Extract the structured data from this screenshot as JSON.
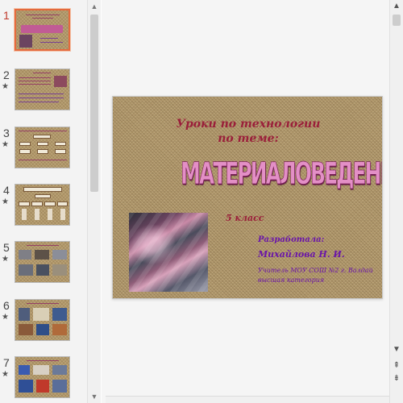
{
  "thumbnails": [
    {
      "number": "1",
      "star": ""
    },
    {
      "number": "2",
      "star": "★"
    },
    {
      "number": "3",
      "star": "★"
    },
    {
      "number": "4",
      "star": "★"
    },
    {
      "number": "5",
      "star": "★"
    },
    {
      "number": "6",
      "star": "★"
    },
    {
      "number": "7",
      "star": "★"
    }
  ],
  "selected_slide": 1,
  "slide": {
    "title_line1": "Уроки по технологии",
    "title_line2": "по теме:",
    "main_word": "МАТЕРИАЛОВЕДЕНИЕ",
    "class_label": "5 класс",
    "developer_label": "Разработала:",
    "developer_name": "Михайлова Н. И.",
    "developer_info": "Учитель МОУ СОШ №2 г. Валдай высшая категория"
  },
  "scrollbar": {
    "up_arrow": "▲",
    "down_arrow": "▼",
    "prev_slide": "⇞",
    "next_slide": "⇟"
  },
  "colors": {
    "selected_thumb_border": "#e46a3e",
    "title_color": "#9a1f3a",
    "main_word_fill": "#e38fc6",
    "developer_color": "#6a16a8",
    "canvas_background": "#b39a6d"
  }
}
